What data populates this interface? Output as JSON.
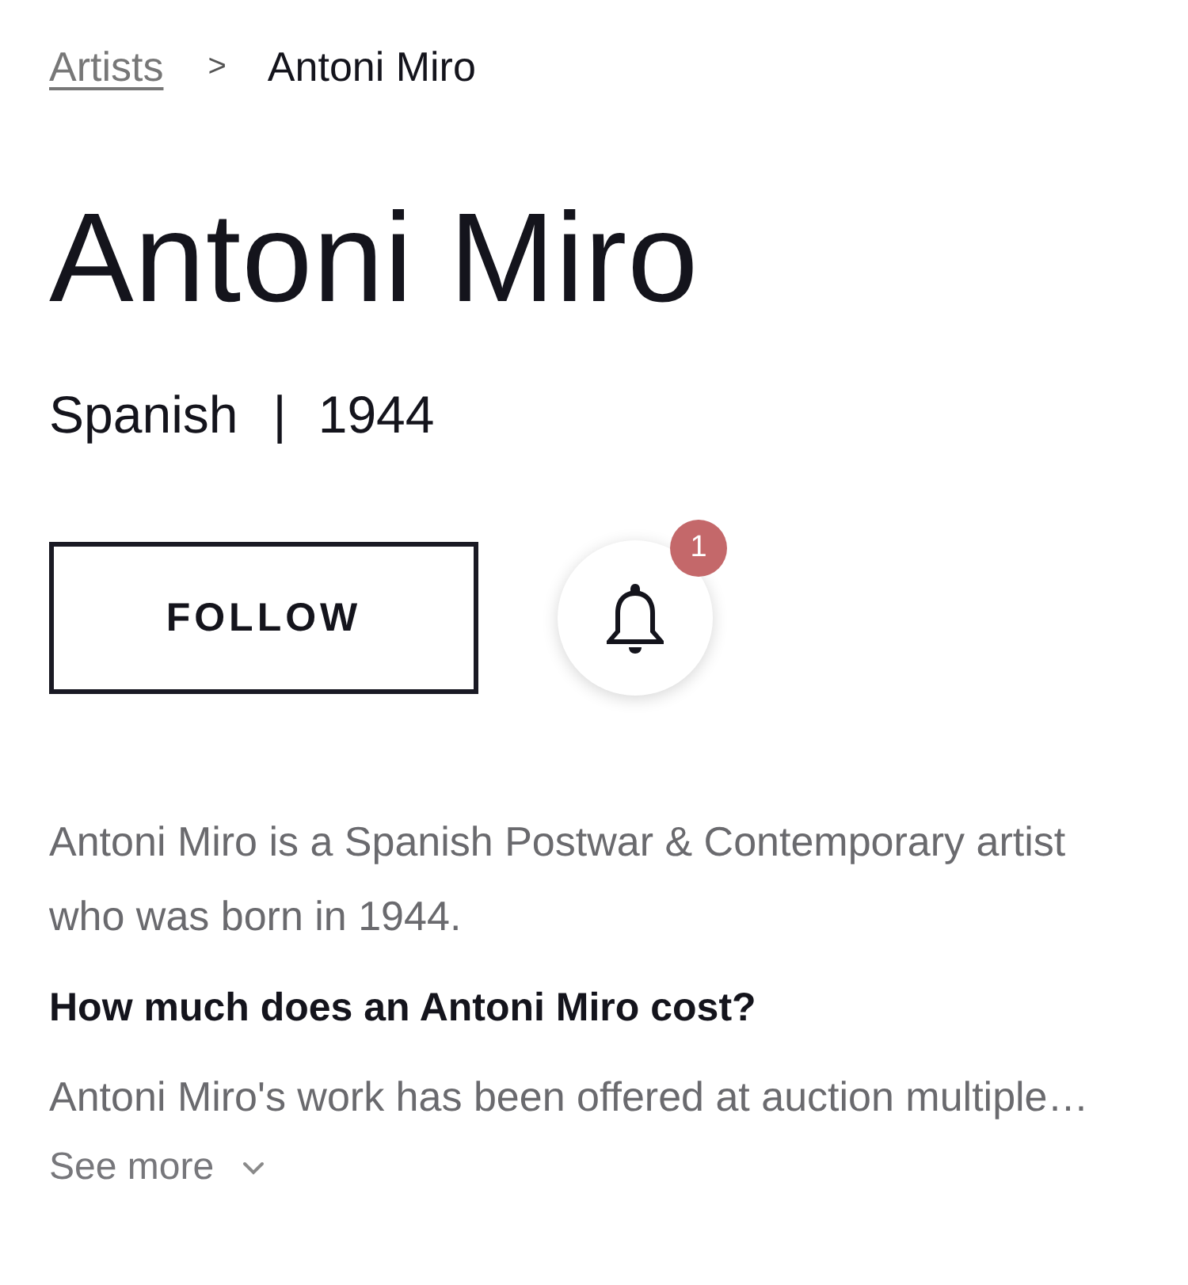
{
  "breadcrumb": [
    {
      "kind": "link",
      "label": "Artists"
    },
    {
      "kind": "separator",
      "label": ">"
    },
    {
      "kind": "current",
      "label": "Antoni Miro"
    }
  ],
  "artist": {
    "name": "Antoni Miro",
    "nationality": "Spanish",
    "separator": "|",
    "born": "1944"
  },
  "actions": {
    "follow_button": "FOLLOW",
    "notification_count": "1"
  },
  "about": {
    "paragraphs": [
      {
        "kind": "text",
        "text": "Antoni Miro is a Spanish Postwar & Contemporary artist who was born in 1944."
      },
      {
        "kind": "heading",
        "text": "How much does an Antoni Miro cost?"
      },
      {
        "kind": "text",
        "text": "Antoni Miro's work has been offered at auction multiple…"
      }
    ],
    "see_more": "See more"
  }
}
